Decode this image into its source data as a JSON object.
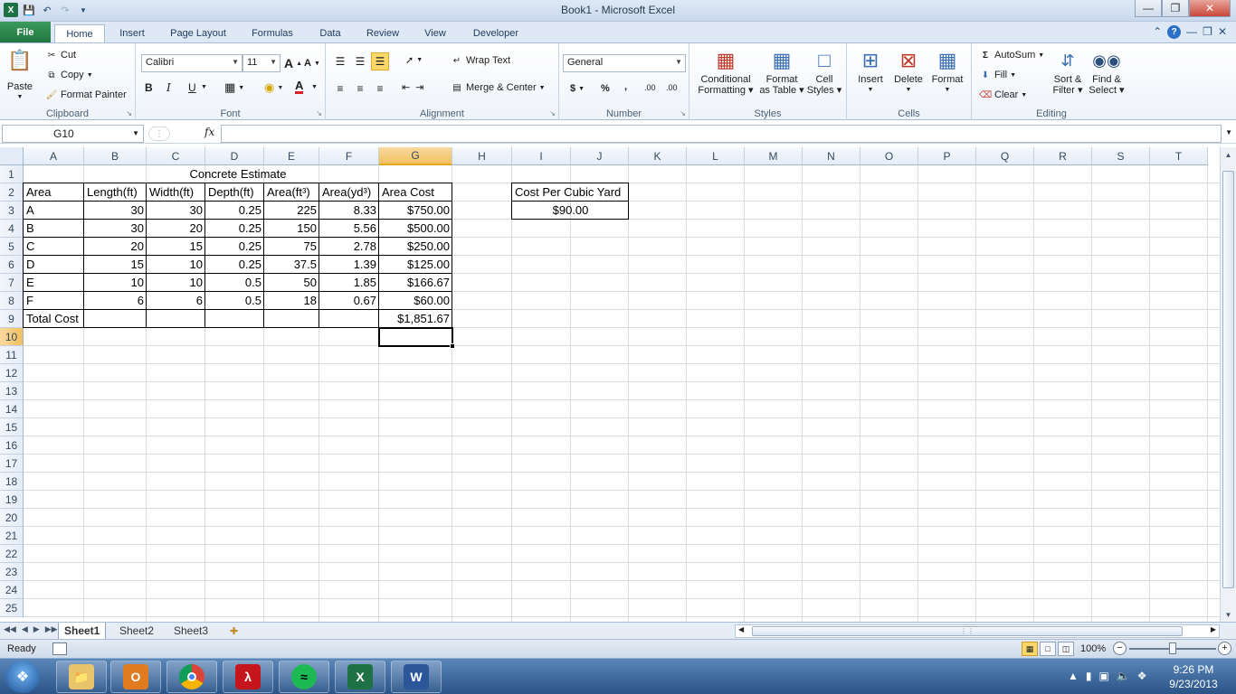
{
  "window": {
    "title": "Book1 - Microsoft Excel",
    "app_icon_letter": "X"
  },
  "tabs": [
    "File",
    "Home",
    "Insert",
    "Page Layout",
    "Formulas",
    "Data",
    "Review",
    "View",
    "Developer"
  ],
  "ribbon": {
    "clipboard": {
      "label": "Clipboard",
      "paste": "Paste",
      "cut": "Cut",
      "copy": "Copy",
      "format_painter": "Format Painter"
    },
    "font": {
      "label": "Font",
      "name": "Calibri",
      "size": "11",
      "bold": "B",
      "italic": "I",
      "underline": "U",
      "grow": "A",
      "shrink": "A",
      "color_glyph": "A"
    },
    "alignment": {
      "label": "Alignment",
      "wrap_text": "Wrap Text",
      "merge_center": "Merge & Center"
    },
    "number": {
      "label": "Number",
      "format": "General",
      "currency": "$",
      "percent": "%",
      "comma": ",",
      "inc_decimal": ".00",
      "dec_decimal": ".00"
    },
    "styles": {
      "label": "Styles",
      "conditional": [
        "Conditional",
        "Formatting"
      ],
      "format_table": [
        "Format",
        "as Table"
      ],
      "cell_styles": [
        "Cell",
        "Styles"
      ]
    },
    "cells": {
      "label": "Cells",
      "insert": "Insert",
      "delete": "Delete",
      "format": "Format"
    },
    "editing": {
      "label": "Editing",
      "autosum": "AutoSum",
      "fill": "Fill",
      "clear": "Clear",
      "sort": [
        "Sort &",
        "Filter"
      ],
      "find": [
        "Find &",
        "Select"
      ]
    }
  },
  "formula_bar": {
    "name_box": "G10",
    "fx": "fx",
    "value": ""
  },
  "columns": [
    "A",
    "B",
    "C",
    "D",
    "E",
    "F",
    "G",
    "H",
    "I",
    "J",
    "K",
    "L",
    "M",
    "N",
    "O",
    "P",
    "Q",
    "R",
    "S",
    "T"
  ],
  "rows": [
    "1",
    "2",
    "3",
    "4",
    "5",
    "6",
    "7",
    "8",
    "9",
    "10",
    "11",
    "12",
    "13",
    "14",
    "15",
    "16",
    "17",
    "18",
    "19",
    "20",
    "21",
    "22",
    "23",
    "24",
    "25"
  ],
  "sheet": {
    "title": "Concrete Estimate",
    "headers": [
      "Area",
      "Length(ft)",
      "Width(ft)",
      "Depth(ft)",
      "Area(ft³)",
      "Area(yd³)",
      "Area Cost"
    ],
    "data": [
      [
        "A",
        "30",
        "30",
        "0.25",
        "225",
        "8.33",
        "$750.00"
      ],
      [
        "B",
        "30",
        "20",
        "0.25",
        "150",
        "5.56",
        "$500.00"
      ],
      [
        "C",
        "20",
        "15",
        "0.25",
        "75",
        "2.78",
        "$250.00"
      ],
      [
        "D",
        "15",
        "10",
        "0.25",
        "37.5",
        "1.39",
        "$125.00"
      ],
      [
        "E",
        "10",
        "10",
        "0.5",
        "50",
        "1.85",
        "$166.67"
      ],
      [
        "F",
        "6",
        "6",
        "0.5",
        "18",
        "0.67",
        "$60.00"
      ]
    ],
    "total_label": "Total Cost",
    "total_value": "$1,851.67",
    "cost_label": "Cost Per Cubic Yard",
    "cost_value": "$90.00"
  },
  "sheet_tabs": [
    "Sheet1",
    "Sheet2",
    "Sheet3"
  ],
  "status": {
    "ready": "Ready",
    "zoom": "100%"
  },
  "taskbar": {
    "apps": [
      "file-explorer",
      "outlook",
      "chrome",
      "acrobat",
      "spotify",
      "excel",
      "word"
    ],
    "clock_time": "9:26 PM",
    "clock_date": "9/23/2013"
  }
}
